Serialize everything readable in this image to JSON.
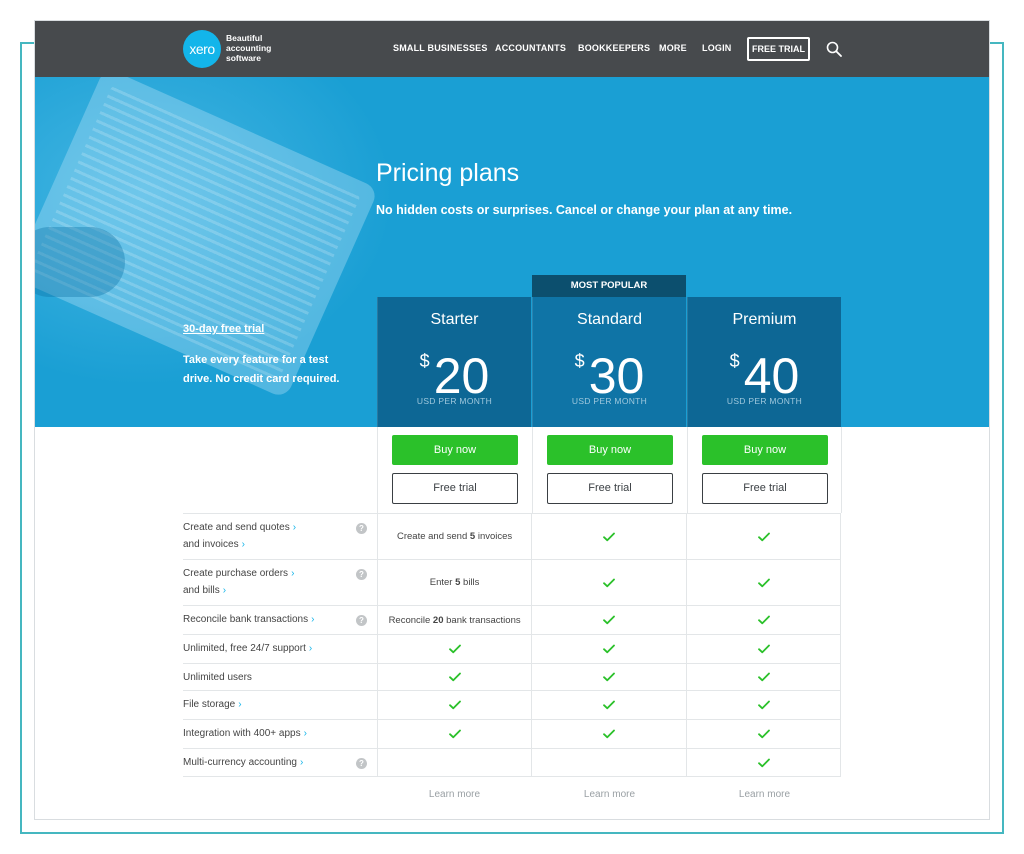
{
  "brand": {
    "logo_text": "xero",
    "tagline": "Beautiful accounting software",
    "color": "#13b5ea"
  },
  "nav": {
    "items": [
      "SMALL BUSINESSES",
      "ACCOUNTANTS",
      "BOOKKEEPERS",
      "MORE",
      "LOGIN"
    ],
    "free_trial": "FREE TRIAL",
    "search_icon": "search-icon"
  },
  "hero": {
    "title": "Pricing plans",
    "subtitle": "No hidden costs or surprises. Cancel or change your plan at any time.",
    "trial_link": "30-day free trial",
    "trial_text": "Take every feature for a test drive. No credit card required.",
    "badge": "MOST POPULAR",
    "color": "#1a9fd4"
  },
  "plans": [
    {
      "name": "Starter",
      "currency": "$",
      "price": "20",
      "period": "USD PER MONTH",
      "buy": "Buy now",
      "trial": "Free trial",
      "learn": "Learn more"
    },
    {
      "name": "Standard",
      "currency": "$",
      "price": "30",
      "period": "USD PER MONTH",
      "buy": "Buy now",
      "trial": "Free trial",
      "learn": "Learn more"
    },
    {
      "name": "Premium",
      "currency": "$",
      "price": "40",
      "period": "USD PER MONTH",
      "buy": "Buy now",
      "trial": "Free trial",
      "learn": "Learn more"
    }
  ],
  "features": [
    {
      "label": "Create and send quotes",
      "label2": "and invoices",
      "help": true,
      "starter": {
        "pre": "Create and send ",
        "num": "5",
        "post": " invoices"
      },
      "standard": "check",
      "premium": "check"
    },
    {
      "label": "Create purchase orders",
      "label2": "and bills",
      "help": true,
      "starter": {
        "pre": "Enter ",
        "num": "5",
        "post": " bills"
      },
      "standard": "check",
      "premium": "check"
    },
    {
      "label": "Reconcile bank transactions",
      "label2": "",
      "help": true,
      "starter": {
        "pre": "Reconcile ",
        "num": "20",
        "post": " bank transactions"
      },
      "standard": "check",
      "premium": "check"
    },
    {
      "label": "Unlimited, free 24/7 support",
      "label2": "",
      "help": false,
      "chev": true,
      "starter": "check",
      "standard": "check",
      "premium": "check"
    },
    {
      "label": "Unlimited users",
      "label2": "",
      "help": false,
      "chev": false,
      "starter": "check",
      "standard": "check",
      "premium": "check"
    },
    {
      "label": "File storage",
      "label2": "",
      "help": false,
      "chev": true,
      "starter": "check",
      "standard": "check",
      "premium": "check"
    },
    {
      "label": "Integration with 400+ apps",
      "label2": "",
      "help": false,
      "chev": true,
      "starter": "check",
      "standard": "check",
      "premium": "check"
    },
    {
      "label": "Multi-currency accounting",
      "label2": "",
      "help": true,
      "chev": true,
      "starter": "",
      "standard": "",
      "premium": "check"
    }
  ],
  "colors": {
    "buy": "#2bc12a",
    "check": "#2bc12a",
    "plan": "#0d6795",
    "badge": "#0c4f6e",
    "topbar": "#474a4d"
  }
}
